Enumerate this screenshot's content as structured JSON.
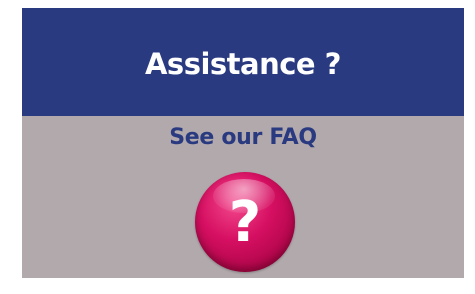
{
  "widget": {
    "title": "Assistance ?",
    "faq_link_label": "See our FAQ",
    "help_icon_glyph": "?",
    "help_icon": "question-mark-icon"
  },
  "colors": {
    "header_background": "#2a3a80",
    "panel_background": "#b1a9ac",
    "link_text": "#2a3a80",
    "help_button": "#d60f62"
  }
}
